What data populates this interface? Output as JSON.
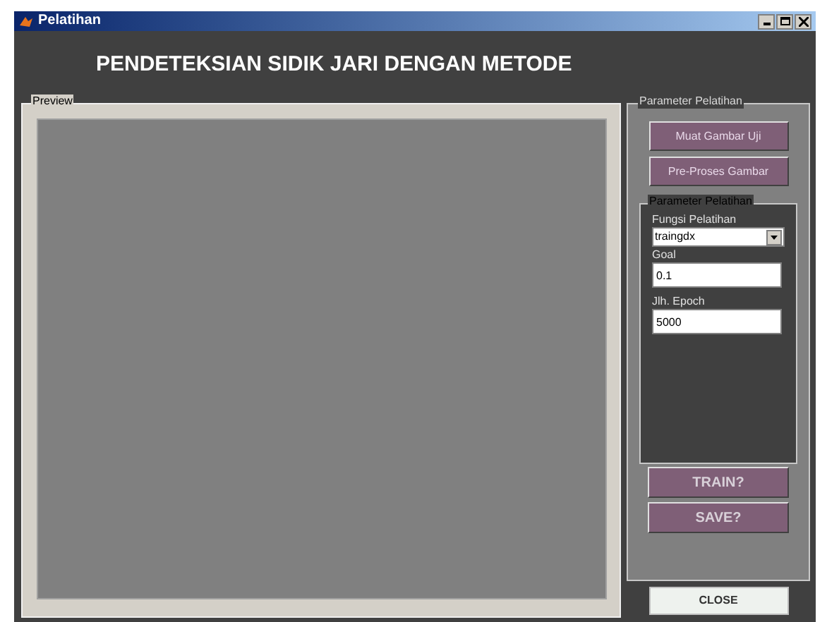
{
  "window": {
    "title": "Pelatihan"
  },
  "heading": "PENDETEKSIAN SIDIK JARI DENGAN METODE",
  "preview": {
    "label": "Preview"
  },
  "parameter_panel": {
    "label": "Parameter Pelatihan",
    "buttons": [
      "Muat Gambar Uji",
      "Pre-Proses Gambar"
    ],
    "inner_panel": {
      "label": "Parameter Pelatihan",
      "fields": [
        {
          "kind": "dropdown",
          "label": "Fungsi Pelatihan",
          "value": "traingdx"
        },
        {
          "kind": "text",
          "label": "Goal",
          "value": "0.1"
        },
        {
          "kind": "text",
          "label": "Jlh. Epoch",
          "value": "5000"
        }
      ]
    },
    "actions": [
      "TRAIN?",
      "SAVE?"
    ]
  },
  "close_button": "CLOSE"
}
